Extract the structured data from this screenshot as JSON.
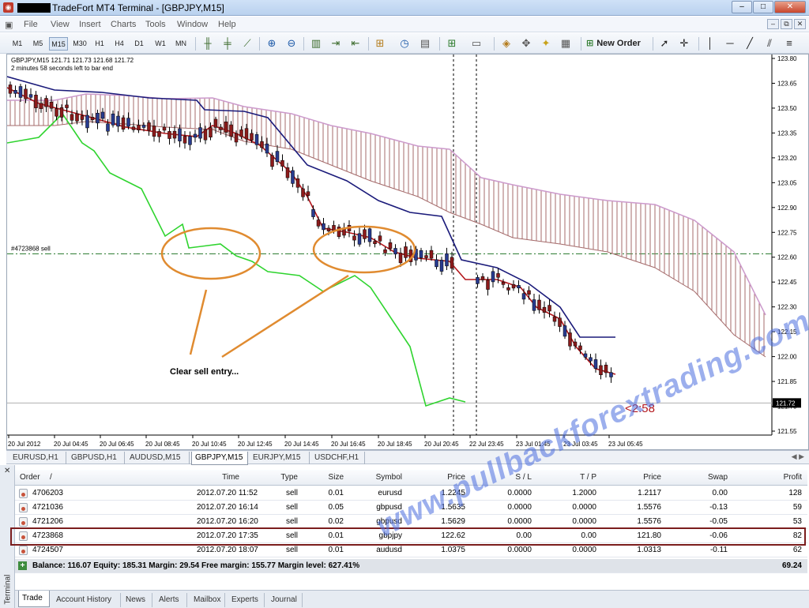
{
  "window": {
    "title": "TradeFort MT4 Terminal - [GBPJPY,M15]",
    "minimize": "–",
    "maximize": "□",
    "close": "✕"
  },
  "menu": [
    "File",
    "View",
    "Insert",
    "Charts",
    "Tools",
    "Window",
    "Help"
  ],
  "mdi_buttons": [
    "–",
    "⧉",
    "✕"
  ],
  "toolbar": {
    "timeframes": [
      "M1",
      "M5",
      "M15",
      "M30",
      "H1",
      "H4",
      "D1",
      "W1",
      "MN"
    ],
    "active_timeframe": "M15",
    "new_order": "New Order",
    "icons": [
      "bar-chart-icon",
      "candles-icon",
      "line-chart-icon",
      "zoom-in-icon",
      "zoom-out-icon",
      "tile-icon",
      "scroll-icon",
      "shift-icon",
      "indicators-icon",
      "periods-icon",
      "templates-icon",
      "new-chart-icon",
      "profiles-icon",
      "market-watch-icon",
      "navigator-icon",
      "data-window-icon",
      "strategy-tester-icon",
      "cursor-icon",
      "crosshair-icon",
      "vertical-line-icon",
      "horizontal-line-icon",
      "trendline-icon",
      "channel-icon",
      "fibo-icon",
      "text-icon",
      "arrow-icon"
    ]
  },
  "chart": {
    "symbol_info": "GBPJPY,M15  121.71 121.73 121.68 121.72",
    "timer_text": "2 minutes 58 seconds left to bar end",
    "order_line_label": "#4723868 sell",
    "annotation": "Clear sell entry...",
    "countdown": "<2:58",
    "current_price": "121.72",
    "watermark": "www.pullbackforextrading.com",
    "price_labels": [
      "123.80",
      "123.65",
      "123.50",
      "123.35",
      "123.20",
      "123.05",
      "122.90",
      "122.75",
      "122.60",
      "122.45",
      "122.30",
      "122.15",
      "122.00",
      "121.85",
      "121.70",
      "121.55"
    ],
    "time_labels": [
      "20 Jul 2012",
      "20 Jul 04:45",
      "20 Jul 06:45",
      "20 Jul 08:45",
      "20 Jul 10:45",
      "20 Jul 12:45",
      "20 Jul 14:45",
      "20 Jul 16:45",
      "20 Jul 18:45",
      "20 Jul 20:45",
      "22 Jul 23:45",
      "23 Jul 01:45",
      "23 Jul 03:45",
      "23 Jul 05:45"
    ],
    "colors": {
      "bull": "#283b8f",
      "bear": "#8c1b1b",
      "tenkan": "#b3161b",
      "kijun": "#1a1a7a",
      "chikou": "#2fd42f",
      "cloud": "#a56b6b",
      "cloud_edge": "#cc9acc",
      "order_line": "#2e7d32",
      "circle": "#e08b30"
    }
  },
  "chart_tabs": [
    "EURUSD,H1",
    "GBPUSD,H1",
    "AUDUSD,M15",
    "GBPJPY,M15",
    "EURJPY,M15",
    "USDCHF,H1"
  ],
  "active_chart_tab": "GBPJPY,M15",
  "terminal": {
    "side_label": "Terminal",
    "close": "✕",
    "columns": [
      "Order",
      "/",
      "Time",
      "Type",
      "Size",
      "Symbol",
      "Price",
      "S / L",
      "T / P",
      "Price",
      "Swap",
      "Profit"
    ],
    "orders": [
      {
        "order": "4706203",
        "time": "2012.07.20 11:52",
        "type": "sell",
        "size": "0.01",
        "symbol": "eurusd",
        "price": "1.2245",
        "sl": "0.0000",
        "tp": "1.2000",
        "cur": "1.2117",
        "swap": "0.00",
        "profit": "128"
      },
      {
        "order": "4721036",
        "time": "2012.07.20 16:14",
        "type": "sell",
        "size": "0.05",
        "symbol": "gbpusd",
        "price": "1.5635",
        "sl": "0.0000",
        "tp": "0.0000",
        "cur": "1.5576",
        "swap": "-0.13",
        "profit": "59"
      },
      {
        "order": "4721206",
        "time": "2012.07.20 16:20",
        "type": "sell",
        "size": "0.02",
        "symbol": "gbpusd",
        "price": "1.5629",
        "sl": "0.0000",
        "tp": "0.0000",
        "cur": "1.5576",
        "swap": "-0.05",
        "profit": "53"
      },
      {
        "order": "4723868",
        "time": "2012.07.20 17:35",
        "type": "sell",
        "size": "0.01",
        "symbol": "gbpjpy",
        "price": "122.62",
        "sl": "0.00",
        "tp": "0.00",
        "cur": "121.80",
        "swap": "-0.06",
        "profit": "82"
      },
      {
        "order": "4724507",
        "time": "2012.07.20 18:07",
        "type": "sell",
        "size": "0.01",
        "symbol": "audusd",
        "price": "1.0375",
        "sl": "0.0000",
        "tp": "0.0000",
        "cur": "1.0313",
        "swap": "-0.11",
        "profit": "62"
      }
    ],
    "balance_line": "Balance: 116.07  Equity: 185.31  Margin: 29.54  Free margin: 155.77  Margin level: 627.41%",
    "balance_profit": "69.24",
    "tabs": [
      "Trade",
      "Account History",
      "News",
      "Alerts",
      "Mailbox",
      "Experts",
      "Journal"
    ],
    "active_tab": "Trade"
  }
}
